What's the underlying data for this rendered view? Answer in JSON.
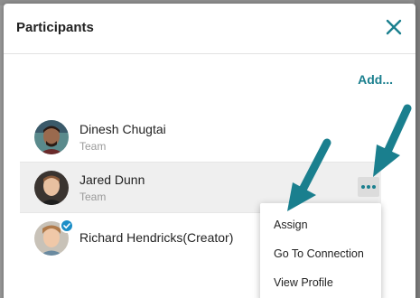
{
  "modal": {
    "title": "Participants",
    "close_icon": "close-icon",
    "add_label": "Add..."
  },
  "participants": [
    {
      "name": "Dinesh Chugtai",
      "role": "Team",
      "avatar_icon": "person-avatar"
    },
    {
      "name": "Jared Dunn",
      "role": "Team",
      "avatar_icon": "person-avatar",
      "highlighted": true
    },
    {
      "name": "Richard Hendricks(Creator)",
      "role": "",
      "avatar_icon": "person-avatar",
      "badge_icon": "check-icon"
    }
  ],
  "menu": {
    "items": [
      "Assign",
      "Go To Connection",
      "View Profile"
    ]
  },
  "colors": {
    "accent": "#1a7f8e",
    "arrow": "#1a7f8e",
    "badge": "#1c8ec7"
  }
}
